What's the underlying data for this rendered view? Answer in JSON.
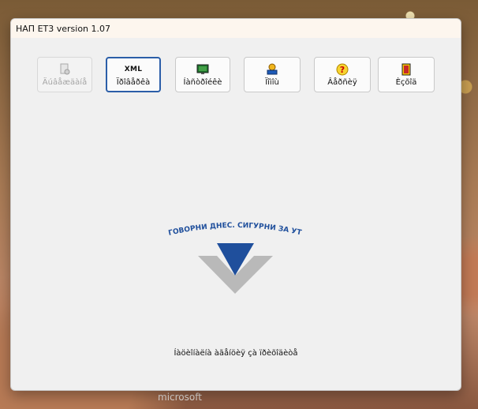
{
  "window": {
    "title": "НАП ЕТ3 version 1.07"
  },
  "toolbar": {
    "buttons": [
      {
        "label": "Äúâåæäàíå",
        "icon": "document-gear-icon",
        "state": "disabled"
      },
      {
        "label": "Ïðîâåðêà",
        "icon": "xml-text-icon",
        "badge": "XML",
        "state": "focused"
      },
      {
        "label": "Íàñòðîéêè",
        "icon": "monitor-icon",
        "state": "normal"
      },
      {
        "label": "Ïîìîù",
        "icon": "help-book-icon",
        "state": "normal"
      },
      {
        "label": "Âåðñèÿ",
        "icon": "question-icon",
        "state": "normal"
      },
      {
        "label": "Èçõîä",
        "icon": "exit-door-icon",
        "state": "normal"
      }
    ]
  },
  "logo": {
    "slogan": "ОТГОВОРНИ ДНЕС. СИГУРНИ ЗА УТРЕ."
  },
  "footer": {
    "text": "Íàöèîíàëíà àãåíöèÿ çà ïðèõîäèòå"
  },
  "background": {
    "watermark": "microsoft"
  },
  "colors": {
    "accent": "#2b5ea8",
    "logo_blue": "#1f4f9c",
    "logo_gray": "#b9b9b9"
  }
}
